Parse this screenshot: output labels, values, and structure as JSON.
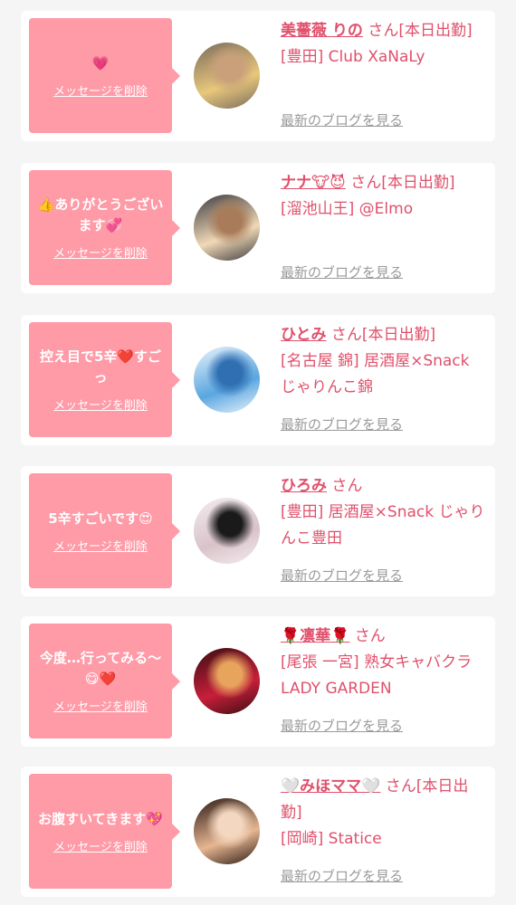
{
  "entries": [
    {
      "message": "💗",
      "delete_label": "メッセージを削除",
      "name": "美薔薇 りの",
      "status": "さん[本日出勤]",
      "shop": "[豊田] Club XaNaLy",
      "blog_label": "最新のブログを見る",
      "avatar_colors": [
        "#7a6a5e",
        "#e8c87a",
        "#c9a07a"
      ]
    },
    {
      "message": "👍ありがとうございます💞",
      "delete_label": "メッセージを削除",
      "name": "ナナ🐮😈",
      "status": "さん[本日出勤]",
      "shop": "[溜池山王] @Elmo",
      "blog_label": "最新のブログを見る",
      "avatar_colors": [
        "#3b3a3f",
        "#f1d9b6",
        "#a87c5b"
      ]
    },
    {
      "message": "控え目で5辛❤️すごっ",
      "delete_label": "メッセージを削除",
      "name": "ひとみ",
      "status": "さん[本日出勤]",
      "shop": "[名古屋 錦] 居酒屋×Snack じゃりんこ錦",
      "blog_label": "最新のブログを見る",
      "avatar_colors": [
        "#eaf3fb",
        "#5aa6e0",
        "#2f6fb2"
      ]
    },
    {
      "message": "5辛すごいです😍",
      "delete_label": "メッセージを削除",
      "name": "ひろみ",
      "status": "さん",
      "shop": "[豊田] 居酒屋×Snack じゃりんこ豊田",
      "blog_label": "最新のブログを見る",
      "avatar_colors": [
        "#f3ecef",
        "#d9c3c9",
        "#1a1a1a"
      ]
    },
    {
      "message": "今度…行ってみる〜😋❤️",
      "delete_label": "メッセージを削除",
      "name": "🌹凛華🌹",
      "status": "さん",
      "shop": "[尾張 一宮] 熟女キャバクラ LADY GARDEN",
      "blog_label": "最新のブログを見る",
      "avatar_colors": [
        "#3a0d12",
        "#c81f3a",
        "#e8a35d"
      ]
    },
    {
      "message": "お腹すいてきます💖",
      "delete_label": "メッセージを削除",
      "name": "🤍みほママ🤍",
      "status": "さん[本日出勤]",
      "shop": "[岡崎] Statice",
      "blog_label": "最新のブログを見る",
      "avatar_colors": [
        "#2a1a14",
        "#e7b691",
        "#f4d7c0"
      ]
    }
  ]
}
